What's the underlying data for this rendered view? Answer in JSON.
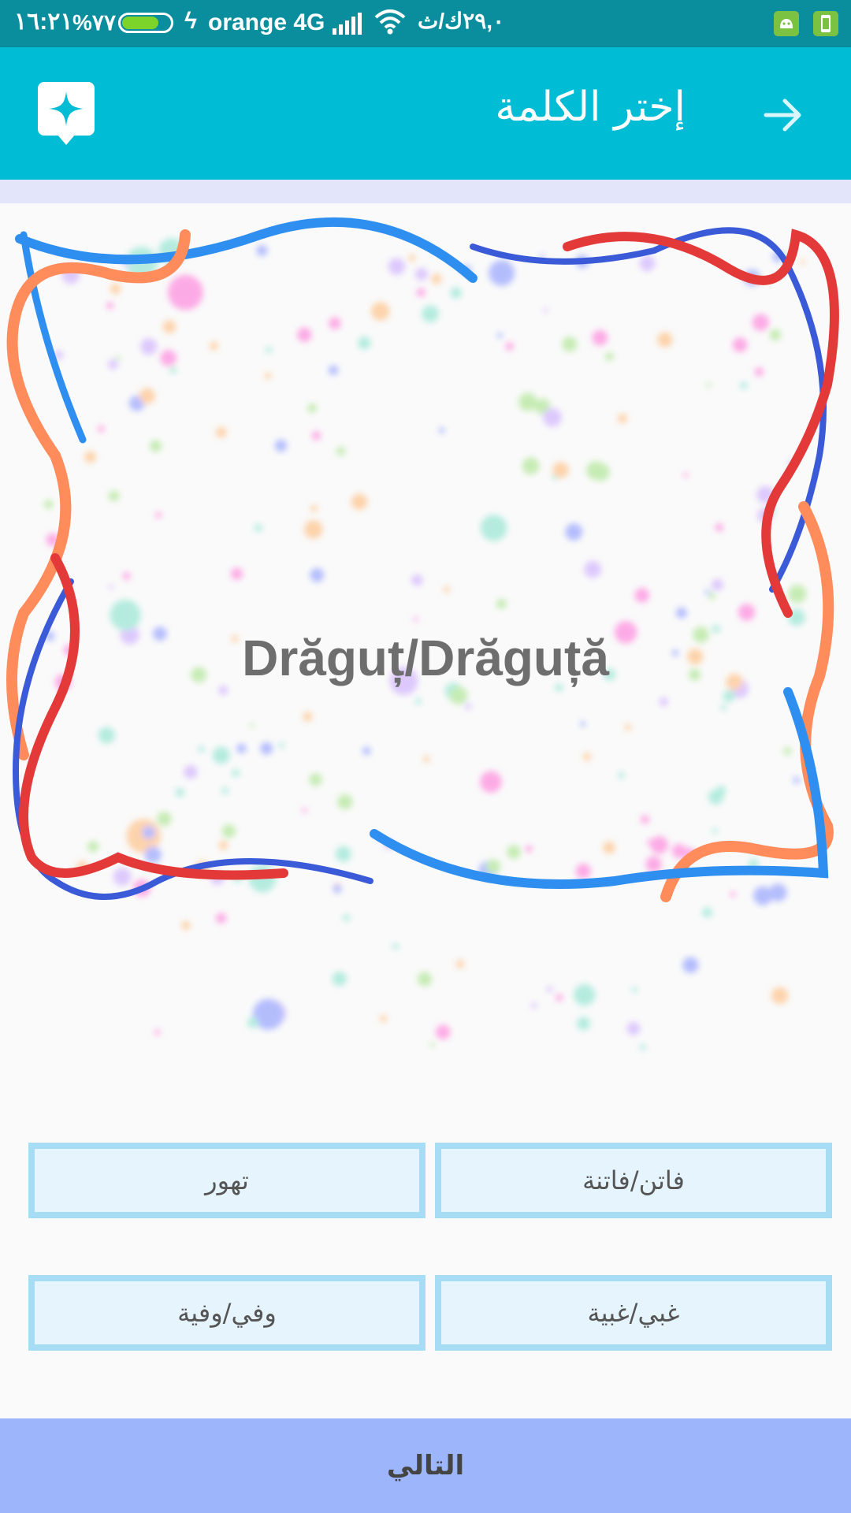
{
  "status_bar": {
    "time": "١٦:٢١",
    "battery_percent": "%٧٧",
    "battery_level": 0.77,
    "carrier": "orange 4G",
    "data_speed": "٢٩,٠ك/ث",
    "icons": [
      "battery-icon",
      "charging-bolt-icon",
      "signal-icon",
      "wifi-icon",
      "android-notification-icon",
      "phone-status-icon"
    ]
  },
  "app_bar": {
    "title": "إختر الكلمة",
    "back_icon": "arrow-right-icon",
    "app_icon": "sparkle-logo-icon"
  },
  "question": {
    "word": "Drăguț/Drăguță"
  },
  "options": [
    {
      "label": "فاتن/فاتنة"
    },
    {
      "label": "تهور"
    },
    {
      "label": "غبي/غبية"
    },
    {
      "label": "وفي/وفية"
    }
  ],
  "footer": {
    "next_label": "التالي"
  },
  "colors": {
    "status_bar": "#0a8d9c",
    "app_bar": "#00bcd4",
    "option_border": "#a6dcf4",
    "option_fill": "#e6f5fd",
    "next_bar": "#9cb5fb"
  }
}
